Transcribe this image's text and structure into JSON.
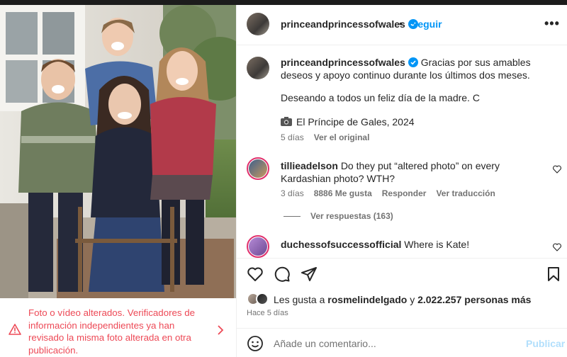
{
  "post": {
    "username": "princeandprincessofwales",
    "separator": "•",
    "follow_label": "Seguir",
    "more_label": "•••"
  },
  "photo_warning": {
    "text": "Foto o vídeo alterados. Verificadores de información independientes ya han revisado la misma foto alterada en otra publicación."
  },
  "caption": {
    "username": "princeandprincessofwales",
    "line1": "Gracias por sus amables deseos y apoyo continuo durante los últimos dos meses.",
    "line2": "Deseando a todos un feliz día de la madre. C",
    "line3": "El Príncipe de Gales, 2024",
    "age": "5 días",
    "see_original": "Ver el original"
  },
  "comments": [
    {
      "username": "tillieadelson",
      "text": "Do they put “altered photo” on every Kardashian photo? WTH?",
      "age": "3 días",
      "likes": "8886 Me gusta",
      "reply": "Responder",
      "translate": "Ver traducción",
      "view_replies": "Ver respuestas (163)",
      "ring_color": "#d6249f"
    },
    {
      "username": "duchessofsuccessofficial",
      "text": "Where is Kate!",
      "ring_color": "#d6249f"
    }
  ],
  "likes": {
    "prefix": "Les gusta a",
    "user": "rosmelindelgado",
    "conj": "y",
    "others": "2.022.257 personas más",
    "when": "Hace 5 días"
  },
  "composer": {
    "placeholder": "Añade un comentario...",
    "publish": "Publicar"
  },
  "colors": {
    "link_blue": "#0095f6",
    "warning_red": "#ed4956",
    "muted": "#737373"
  },
  "icons": [
    "verified-badge-icon",
    "more-icon",
    "camera-emoji-icon",
    "heart-icon",
    "comment-icon",
    "share-icon",
    "bookmark-icon",
    "emoji-icon",
    "warning-triangle-icon",
    "chevron-right-icon"
  ]
}
